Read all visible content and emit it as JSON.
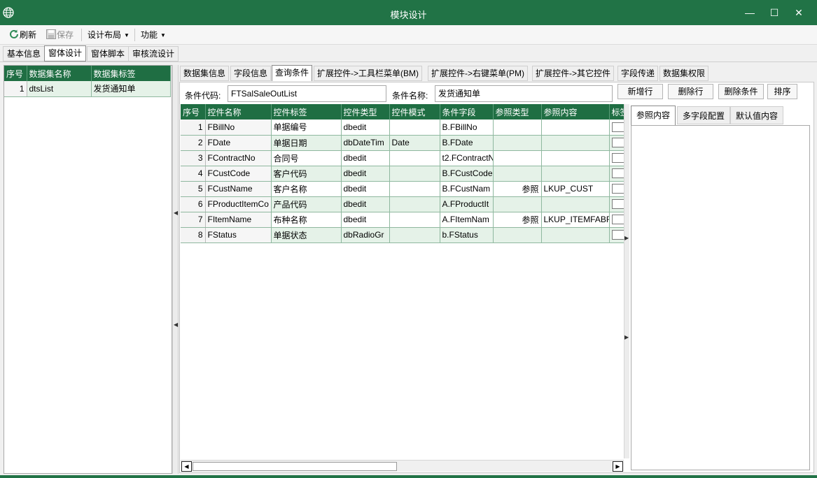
{
  "window": {
    "title": "模块设计"
  },
  "toolbar": {
    "refresh": "刷新",
    "save": "保存",
    "layout": "设计布局",
    "functions": "功能"
  },
  "main_tabs": [
    "基本信息",
    "窗体设计",
    "窗体脚本",
    "审核流设计"
  ],
  "dataset_grid": {
    "columns": [
      "序号",
      "数据集名称",
      "数据集标签"
    ],
    "rows": [
      [
        "1",
        "dtsList",
        "发货通知单"
      ]
    ]
  },
  "sub_tabs": [
    "数据集信息",
    "字段信息",
    "查询条件",
    "扩展控件->工具栏菜单(BM)",
    "扩展控件->右键菜单(PM)",
    "扩展控件->其它控件",
    "字段传递",
    "数据集权限"
  ],
  "query": {
    "code_label": "条件代码:",
    "code_value": "FTSalSaleOutList",
    "name_label": "条件名称:",
    "name_value": "发货通知单",
    "buttons": {
      "add_row": "新增行",
      "delete_row": "删除行",
      "delete_condition": "删除条件",
      "sort": "排序"
    }
  },
  "condition_grid": {
    "columns": [
      "序号",
      "控件名称",
      "控件标签",
      "控件类型",
      "控件模式",
      "条件字段",
      "参照类型",
      "参照内容",
      "标签"
    ],
    "rows": [
      [
        "1",
        "FBillNo",
        "单据编号",
        "dbedit",
        "",
        "B.FBillNo",
        "",
        ""
      ],
      [
        "2",
        "FDate",
        "单据日期",
        "dbDateTim",
        "Date",
        "B.FDate",
        "",
        ""
      ],
      [
        "3",
        "FContractNo",
        "合同号",
        "dbedit",
        "",
        "t2.FContractN",
        "",
        ""
      ],
      [
        "4",
        "FCustCode",
        "客户代码",
        "dbedit",
        "",
        "B.FCustCode",
        "",
        ""
      ],
      [
        "5",
        "FCustName",
        "客户名称",
        "dbedit",
        "",
        "B.FCustNam",
        "参照",
        "LKUP_CUST"
      ],
      [
        "6",
        "FProductItemCo",
        "产品代码",
        "dbedit",
        "",
        "A.FProductIt",
        "",
        ""
      ],
      [
        "7",
        "FItemName",
        "布种名称",
        "dbedit",
        "",
        "A.FItemNam",
        "参照",
        "LKUP_ITEMFABR"
      ],
      [
        "8",
        "FStatus",
        "单据状态",
        "dbRadioGr",
        "",
        "b.FStatus",
        "",
        ""
      ]
    ]
  },
  "right_tabs": [
    "参照内容",
    "多字段配置",
    "默认值内容"
  ],
  "colors": {
    "brand": "#217346",
    "header": "#1f6e43",
    "row_alt": "#e5f2e8"
  }
}
